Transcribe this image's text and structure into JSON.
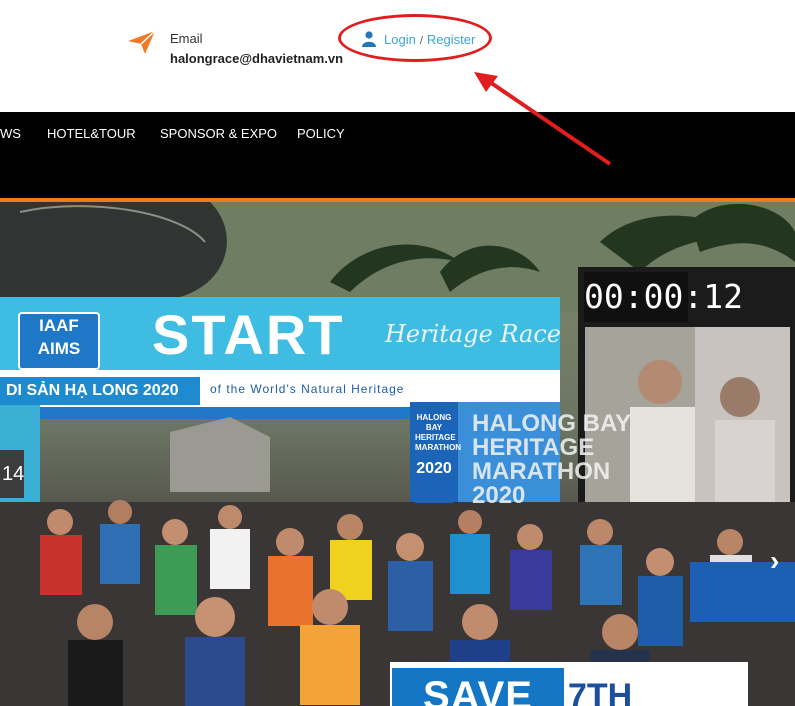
{
  "header": {
    "email_label": "Email",
    "email_value": "halongrace@dhavietnam.vn",
    "login_label": "Login",
    "separator": "/",
    "register_label": "Register"
  },
  "nav": {
    "items": [
      "WS",
      "HOTEL&TOUR",
      "SPONSOR & EXPO",
      "POLICY"
    ]
  },
  "hero": {
    "start": "START",
    "script": "Heritage Race",
    "iaaf_line1": "IAAF",
    "iaaf_line2": "AIMS",
    "race_title": "DI SẢN HẠ LONG 2020",
    "banner_line": "of the World's Natural Heritage",
    "timer": "00:00:12",
    "side_number": "14",
    "halong_sign": "HALONG BAY HERITAGE MARATHON",
    "halong_year": "2020",
    "halong_big_line1": "HALONG BAY",
    "halong_big_line2": "HERITAGE",
    "halong_big_line3": "MARATHON",
    "halong_big_line4": "2020",
    "save_label": "SAVE",
    "date_label": "7TH"
  },
  "colors": {
    "nav_background": "#000000",
    "accent_orange": "#f0781e",
    "link_blue": "#3aa6d8",
    "annotation_red": "#e01e1e",
    "brand_blue": "#1476c4"
  },
  "icons": {
    "email": "paper-plane-icon",
    "user": "user-icon",
    "next": "chevron-right-icon"
  }
}
